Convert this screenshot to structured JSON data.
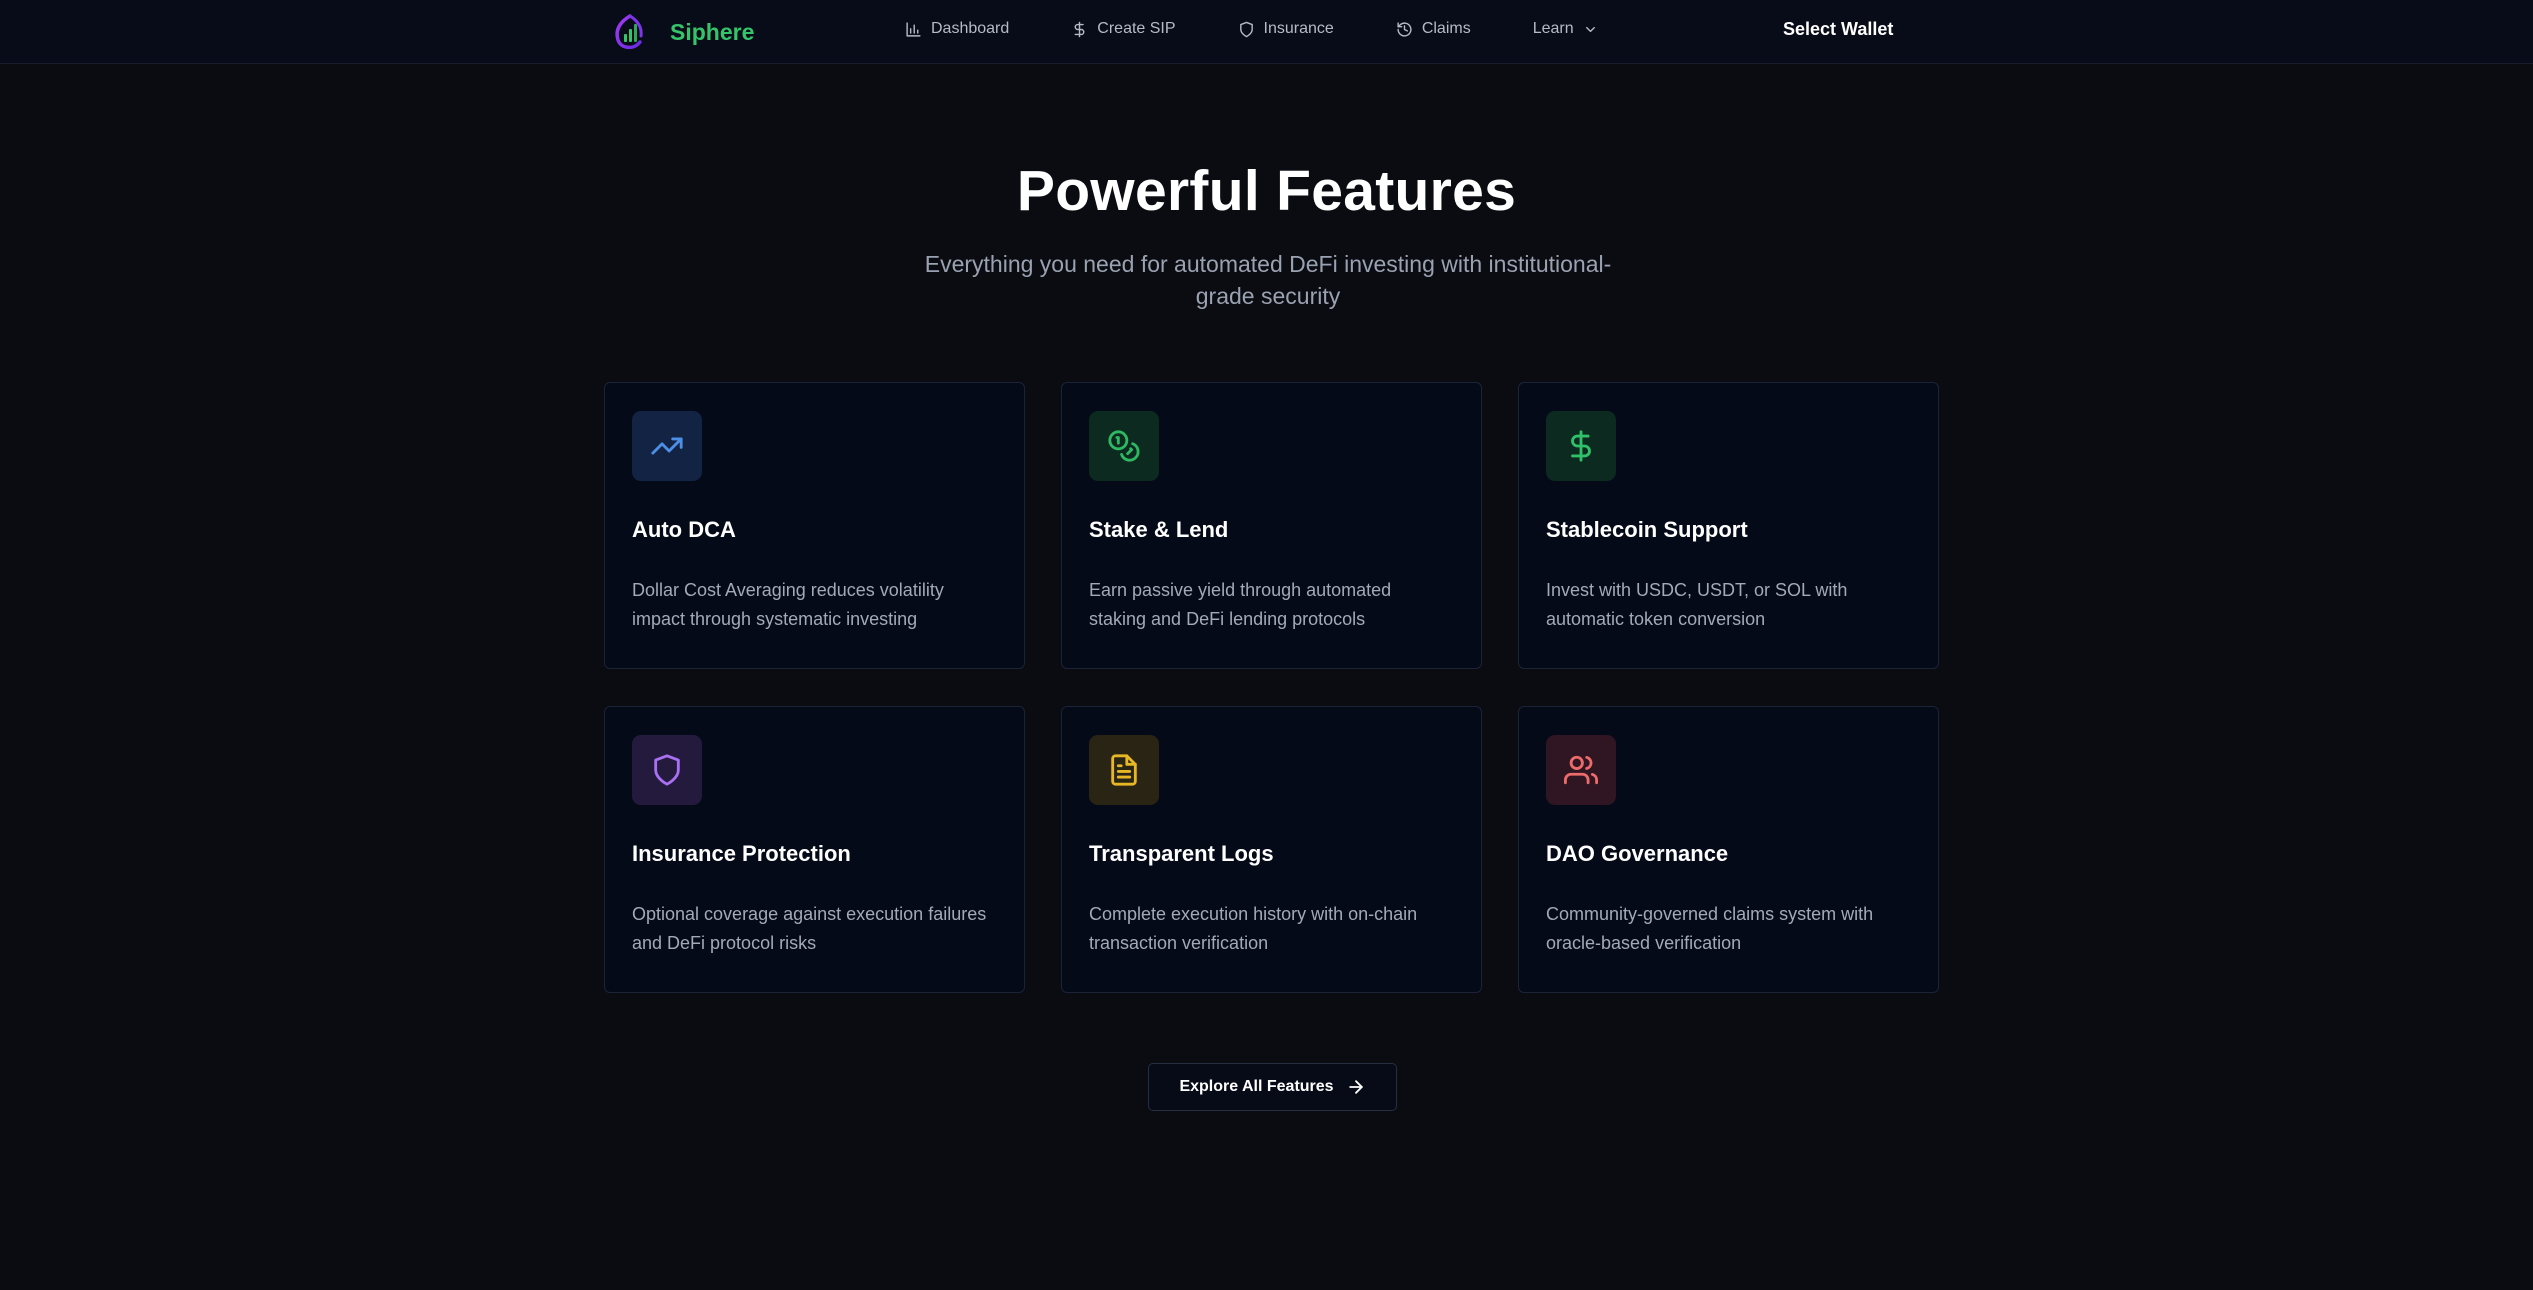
{
  "nav": {
    "brand": "Siphere",
    "logo_icon": "siphere-logo-icon",
    "links": [
      {
        "label": "Dashboard",
        "icon": "bar-chart-icon"
      },
      {
        "label": "Create SIP",
        "icon": "dollar-icon"
      },
      {
        "label": "Insurance",
        "icon": "shield-icon"
      },
      {
        "label": "Claims",
        "icon": "history-icon"
      },
      {
        "label": "Learn",
        "icon": "chevron-down-icon"
      }
    ],
    "wallet_label": "Select Wallet"
  },
  "hero": {
    "title": "Powerful Features",
    "subtitle": "Everything you need for automated DeFi investing with institutional-grade security"
  },
  "features": [
    {
      "title": "Auto DCA",
      "desc": "Dollar Cost Averaging reduces volatility impact through systematic investing",
      "icon": "trending-up-icon",
      "color": "#4e8fe6",
      "bg": "#122344"
    },
    {
      "title": "Stake & Lend",
      "desc": "Earn passive yield through automated staking and DeFi lending protocols",
      "icon": "coins-icon",
      "color": "#2fb862",
      "bg": "#0c2a1f"
    },
    {
      "title": "Stablecoin Support",
      "desc": "Invest with USDC, USDT, or SOL with automatic token conversion",
      "icon": "dollar-icon",
      "color": "#30c06a",
      "bg": "#0c2a1f"
    },
    {
      "title": "Insurance Protection",
      "desc": "Optional coverage against execution failures and DeFi protocol risks",
      "icon": "shield-icon",
      "color": "#a970f2",
      "bg": "#241a3e"
    },
    {
      "title": "Transparent Logs",
      "desc": "Complete execution history with on-chain transaction verification",
      "icon": "document-icon",
      "color": "#e8b724",
      "bg": "#2a2414"
    },
    {
      "title": "DAO Governance",
      "desc": "Community-governed claims system with oracle-based verification",
      "icon": "users-icon",
      "color": "#ec6b6b",
      "bg": "#301522"
    }
  ],
  "cta": {
    "label": "Explore All Features",
    "icon": "arrow-right-icon"
  }
}
